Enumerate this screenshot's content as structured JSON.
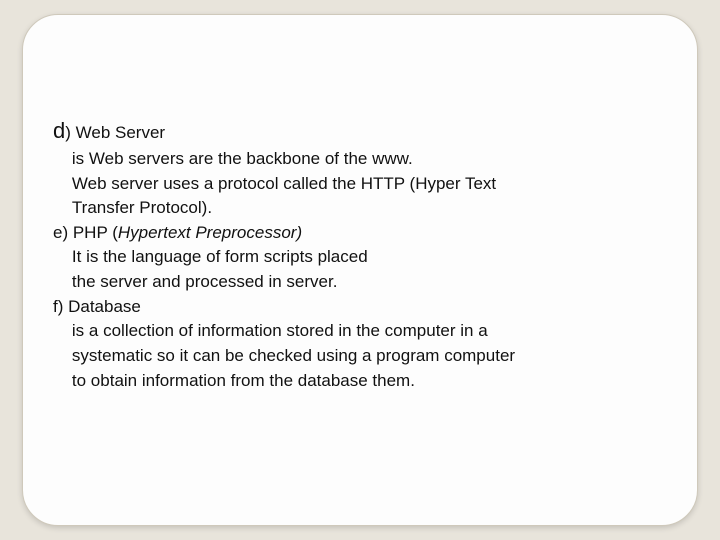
{
  "slide": {
    "items_d": {
      "label": "d",
      "close": ")",
      "title": " Web Server",
      "line1": "    is Web servers are the backbone of the www.",
      "line2": "    Web server uses a protocol called the HTTP (Hyper Text",
      "line3": "    Transfer Protocol)."
    },
    "items_e": {
      "prefix": "e) PHP (",
      "italic": "Hypertext Preprocessor)",
      "line1": "    It is the language of form scripts placed",
      "line2": "    the server and processed in server."
    },
    "items_f": {
      "label": "f) Database",
      "line1": "    is a collection of information stored in the computer in a",
      "line2": "    systematic so it can be checked using a program computer",
      "line3": "    to obtain information from the database them."
    }
  }
}
